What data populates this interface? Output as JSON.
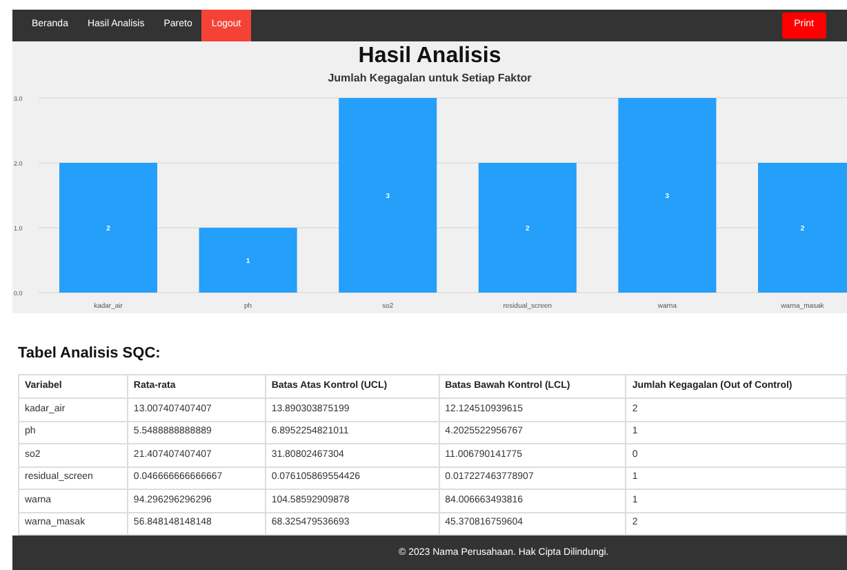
{
  "nav": {
    "links": [
      {
        "label": "Beranda",
        "selected": false
      },
      {
        "label": "Hasil Analisis",
        "selected": false
      },
      {
        "label": "Pareto",
        "selected": false
      },
      {
        "label": "Logout",
        "selected": true
      }
    ],
    "print_button": "Print"
  },
  "title": "Hasil Analisis",
  "chart_data": {
    "type": "bar",
    "title": "Jumlah Kegagalan untuk Setiap Faktor",
    "categories": [
      "kadar_air",
      "ph",
      "so2",
      "residual_screen",
      "warna",
      "warna_masak"
    ],
    "series": [
      {
        "color": "#249ffa",
        "values": [
          2,
          1,
          3,
          2,
          3,
          2
        ]
      }
    ],
    "ylim": [
      0,
      3
    ],
    "yticks": [
      {
        "value": 0,
        "label": "0.0"
      },
      {
        "value": 1,
        "label": "1.0"
      },
      {
        "value": 2,
        "label": "2.0"
      },
      {
        "value": 3,
        "label": "3.0"
      }
    ],
    "data_labels": true
  },
  "table": {
    "heading": "Tabel Analisis SQC:",
    "columns": [
      "Variabel",
      "Rata-rata",
      "Batas Atas Kontrol (UCL)",
      "Batas Bawah Kontrol (LCL)",
      "Jumlah Kegagalan (Out of Control)"
    ],
    "rows": [
      [
        "kadar_air",
        "13.007407407407",
        "13.890303875199",
        "12.124510939615",
        "2"
      ],
      [
        "ph",
        "5.5488888888889",
        "6.8952254821011",
        "4.2025522956767",
        "1"
      ],
      [
        "so2",
        "21.407407407407",
        "31.80802467304",
        "11.006790141775",
        "0"
      ],
      [
        "residual_screen",
        "0.046666666666667",
        "0.076105869554426",
        "0.017227463778907",
        "1"
      ],
      [
        "warna",
        "94.296296296296",
        "104.58592909878",
        "84.006663493816",
        "1"
      ],
      [
        "warna_masak",
        "56.848148148148",
        "68.325479536693",
        "45.370816759604",
        "2"
      ]
    ]
  },
  "footer": "© 2023 Nama Perusahaan. Hak Cipta Dilindungi."
}
